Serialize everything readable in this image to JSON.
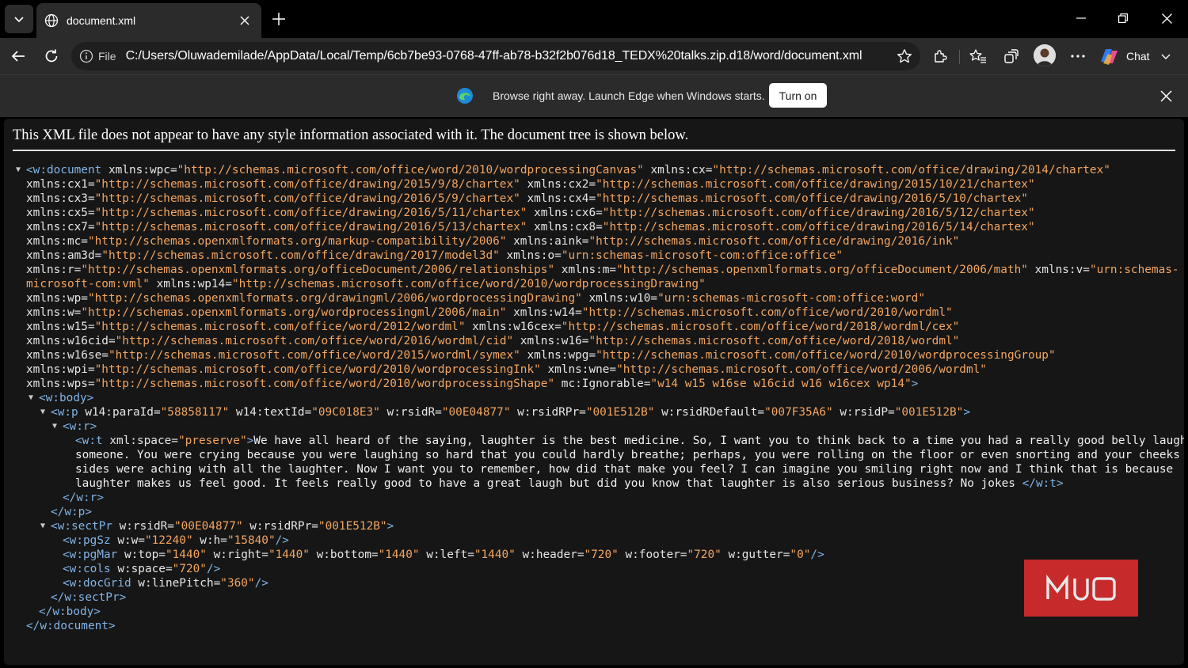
{
  "tab": {
    "title": "document.xml"
  },
  "address": {
    "scheme_label": "File",
    "url": "C:/Users/Oluwademilade/AppData/Local/Temp/6cb7be93-0768-47ff-ab78-b32f2b076d18_TEDX%20talks.zip.d18/word/document.xml"
  },
  "toolbar": {
    "chat_label": "Chat"
  },
  "banner": {
    "message": "Browse right away. Launch Edge when Windows starts.",
    "button_label": "Turn on"
  },
  "page": {
    "header": "This XML file does not appear to have any style information associated with it. The document tree is shown below."
  },
  "xml_lines": [
    {
      "indent": 28,
      "arrow": "open",
      "parts": [
        [
          "tag",
          "<w:document"
        ],
        [
          "an",
          " xmlns:wpc="
        ],
        [
          "av",
          "\"http://schemas.microsoft.com/office/word/2010/wordprocessingCanvas\""
        ],
        [
          "an",
          " xmlns:cx="
        ],
        [
          "av",
          "\"http://schemas.microsoft.com/office/drawing/2014/chartex\""
        ]
      ]
    },
    {
      "indent": 28,
      "parts": [
        [
          "an",
          "xmlns:cx1="
        ],
        [
          "av",
          "\"http://schemas.microsoft.com/office/drawing/2015/9/8/chartex\""
        ],
        [
          "an",
          " xmlns:cx2="
        ],
        [
          "av",
          "\"http://schemas.microsoft.com/office/drawing/2015/10/21/chartex\""
        ]
      ]
    },
    {
      "indent": 28,
      "parts": [
        [
          "an",
          "xmlns:cx3="
        ],
        [
          "av",
          "\"http://schemas.microsoft.com/office/drawing/2016/5/9/chartex\""
        ],
        [
          "an",
          " xmlns:cx4="
        ],
        [
          "av",
          "\"http://schemas.microsoft.com/office/drawing/2016/5/10/chartex\""
        ]
      ]
    },
    {
      "indent": 28,
      "parts": [
        [
          "an",
          "xmlns:cx5="
        ],
        [
          "av",
          "\"http://schemas.microsoft.com/office/drawing/2016/5/11/chartex\""
        ],
        [
          "an",
          " xmlns:cx6="
        ],
        [
          "av",
          "\"http://schemas.microsoft.com/office/drawing/2016/5/12/chartex\""
        ]
      ]
    },
    {
      "indent": 28,
      "parts": [
        [
          "an",
          "xmlns:cx7="
        ],
        [
          "av",
          "\"http://schemas.microsoft.com/office/drawing/2016/5/13/chartex\""
        ],
        [
          "an",
          " xmlns:cx8="
        ],
        [
          "av",
          "\"http://schemas.microsoft.com/office/drawing/2016/5/14/chartex\""
        ]
      ]
    },
    {
      "indent": 28,
      "parts": [
        [
          "an",
          "xmlns:mc="
        ],
        [
          "av",
          "\"http://schemas.openxmlformats.org/markup-compatibility/2006\""
        ],
        [
          "an",
          " xmlns:aink="
        ],
        [
          "av",
          "\"http://schemas.microsoft.com/office/drawing/2016/ink\""
        ]
      ]
    },
    {
      "indent": 28,
      "parts": [
        [
          "an",
          "xmlns:am3d="
        ],
        [
          "av",
          "\"http://schemas.microsoft.com/office/drawing/2017/model3d\""
        ],
        [
          "an",
          " xmlns:o="
        ],
        [
          "av",
          "\"urn:schemas-microsoft-com:office:office\""
        ]
      ]
    },
    {
      "indent": 28,
      "parts": [
        [
          "an",
          "xmlns:r="
        ],
        [
          "av",
          "\"http://schemas.openxmlformats.org/officeDocument/2006/relationships\""
        ],
        [
          "an",
          " xmlns:m="
        ],
        [
          "av",
          "\"http://schemas.openxmlformats.org/officeDocument/2006/math\""
        ],
        [
          "an",
          " xmlns:v="
        ],
        [
          "av",
          "\"urn:schemas-"
        ]
      ]
    },
    {
      "indent": 28,
      "parts": [
        [
          "av",
          "microsoft-com:vml\""
        ],
        [
          "an",
          " xmlns:wp14="
        ],
        [
          "av",
          "\"http://schemas.microsoft.com/office/word/2010/wordprocessingDrawing\""
        ]
      ]
    },
    {
      "indent": 28,
      "parts": [
        [
          "an",
          "xmlns:wp="
        ],
        [
          "av",
          "\"http://schemas.openxmlformats.org/drawingml/2006/wordprocessingDrawing\""
        ],
        [
          "an",
          " xmlns:w10="
        ],
        [
          "av",
          "\"urn:schemas-microsoft-com:office:word\""
        ]
      ]
    },
    {
      "indent": 28,
      "parts": [
        [
          "an",
          "xmlns:w="
        ],
        [
          "av",
          "\"http://schemas.openxmlformats.org/wordprocessingml/2006/main\""
        ],
        [
          "an",
          " xmlns:w14="
        ],
        [
          "av",
          "\"http://schemas.microsoft.com/office/word/2010/wordml\""
        ]
      ]
    },
    {
      "indent": 28,
      "parts": [
        [
          "an",
          "xmlns:w15="
        ],
        [
          "av",
          "\"http://schemas.microsoft.com/office/word/2012/wordml\""
        ],
        [
          "an",
          " xmlns:w16cex="
        ],
        [
          "av",
          "\"http://schemas.microsoft.com/office/word/2018/wordml/cex\""
        ]
      ]
    },
    {
      "indent": 28,
      "parts": [
        [
          "an",
          "xmlns:w16cid="
        ],
        [
          "av",
          "\"http://schemas.microsoft.com/office/word/2016/wordml/cid\""
        ],
        [
          "an",
          " xmlns:w16="
        ],
        [
          "av",
          "\"http://schemas.microsoft.com/office/word/2018/wordml\""
        ]
      ]
    },
    {
      "indent": 28,
      "parts": [
        [
          "an",
          "xmlns:w16se="
        ],
        [
          "av",
          "\"http://schemas.microsoft.com/office/word/2015/wordml/symex\""
        ],
        [
          "an",
          " xmlns:wpg="
        ],
        [
          "av",
          "\"http://schemas.microsoft.com/office/word/2010/wordprocessingGroup\""
        ]
      ]
    },
    {
      "indent": 28,
      "parts": [
        [
          "an",
          "xmlns:wpi="
        ],
        [
          "av",
          "\"http://schemas.microsoft.com/office/word/2010/wordprocessingInk\""
        ],
        [
          "an",
          " xmlns:wne="
        ],
        [
          "av",
          "\"http://schemas.microsoft.com/office/word/2006/wordml\""
        ]
      ]
    },
    {
      "indent": 28,
      "parts": [
        [
          "an",
          "xmlns:wps="
        ],
        [
          "av",
          "\"http://schemas.microsoft.com/office/word/2010/wordprocessingShape\""
        ],
        [
          "an",
          " mc:Ignorable="
        ],
        [
          "av",
          "\"w14 w15 w16se w16cid w16 w16cex wp14\""
        ],
        [
          "tag",
          ">"
        ]
      ]
    },
    {
      "indent": 44,
      "arrow": "open",
      "parts": [
        [
          "tag",
          "<w:body>"
        ]
      ]
    },
    {
      "indent": 59,
      "arrow": "open",
      "parts": [
        [
          "tag",
          "<w:p"
        ],
        [
          "an",
          " w14:paraId="
        ],
        [
          "av",
          "\"58858117\""
        ],
        [
          "an",
          " w14:textId="
        ],
        [
          "av",
          "\"09C018E3\""
        ],
        [
          "an",
          " w:rsidR="
        ],
        [
          "av",
          "\"00E04877\""
        ],
        [
          "an",
          " w:rsidRPr="
        ],
        [
          "av",
          "\"001E512B\""
        ],
        [
          "an",
          " w:rsidRDefault="
        ],
        [
          "av",
          "\"007F35A6\""
        ],
        [
          "an",
          " w:rsidP="
        ],
        [
          "av",
          "\"001E512B\""
        ],
        [
          "tag",
          ">"
        ]
      ]
    },
    {
      "indent": 74,
      "arrow": "open",
      "parts": [
        [
          "tag",
          "<w:r>"
        ]
      ]
    },
    {
      "indent": 90,
      "parts": [
        [
          "tag",
          "<w:t"
        ],
        [
          "an",
          " xml:space="
        ],
        [
          "av",
          "\"preserve\""
        ],
        [
          "tag",
          ">"
        ],
        [
          "tx",
          "We have all heard of the saying, laughter is the best medicine. So, I want you to think back to a time you had a really good belly laugh with"
        ]
      ]
    },
    {
      "indent": 90,
      "parts": [
        [
          "tx",
          "someone. You were crying because you were laughing so hard that you could hardly breathe; perhaps, you were rolling on the floor or even snorting and your cheeks and"
        ]
      ]
    },
    {
      "indent": 90,
      "parts": [
        [
          "tx",
          "sides were aching with all the laughter. Now I want you to remember, how did that make you feel? I can imagine you smiling right now and I think that is because"
        ]
      ]
    },
    {
      "indent": 90,
      "parts": [
        [
          "tx",
          "laughter makes us feel good. It feels really good to have a great laugh but did you know that laughter is also serious business? No jokes "
        ],
        [
          "tag",
          "</w:t>"
        ]
      ]
    },
    {
      "indent": 74,
      "parts": [
        [
          "tag",
          "</w:r>"
        ]
      ]
    },
    {
      "indent": 59,
      "parts": [
        [
          "tag",
          "</w:p>"
        ]
      ]
    },
    {
      "indent": 59,
      "arrow": "open",
      "parts": [
        [
          "tag",
          "<w:sectPr"
        ],
        [
          "an",
          " w:rsidR="
        ],
        [
          "av",
          "\"00E04877\""
        ],
        [
          "an",
          " w:rsidRPr="
        ],
        [
          "av",
          "\"001E512B\""
        ],
        [
          "tag",
          ">"
        ]
      ]
    },
    {
      "indent": 74,
      "parts": [
        [
          "tag",
          "<w:pgSz"
        ],
        [
          "an",
          " w:w="
        ],
        [
          "av",
          "\"12240\""
        ],
        [
          "an",
          " w:h="
        ],
        [
          "av",
          "\"15840\""
        ],
        [
          "tag",
          "/>"
        ]
      ]
    },
    {
      "indent": 74,
      "parts": [
        [
          "tag",
          "<w:pgMar"
        ],
        [
          "an",
          " w:top="
        ],
        [
          "av",
          "\"1440\""
        ],
        [
          "an",
          " w:right="
        ],
        [
          "av",
          "\"1440\""
        ],
        [
          "an",
          " w:bottom="
        ],
        [
          "av",
          "\"1440\""
        ],
        [
          "an",
          " w:left="
        ],
        [
          "av",
          "\"1440\""
        ],
        [
          "an",
          " w:header="
        ],
        [
          "av",
          "\"720\""
        ],
        [
          "an",
          " w:footer="
        ],
        [
          "av",
          "\"720\""
        ],
        [
          "an",
          " w:gutter="
        ],
        [
          "av",
          "\"0\""
        ],
        [
          "tag",
          "/>"
        ]
      ]
    },
    {
      "indent": 74,
      "parts": [
        [
          "tag",
          "<w:cols"
        ],
        [
          "an",
          " w:space="
        ],
        [
          "av",
          "\"720\""
        ],
        [
          "tag",
          "/>"
        ]
      ]
    },
    {
      "indent": 74,
      "parts": [
        [
          "tag",
          "<w:docGrid"
        ],
        [
          "an",
          " w:linePitch="
        ],
        [
          "av",
          "\"360\""
        ],
        [
          "tag",
          "/>"
        ]
      ]
    },
    {
      "indent": 59,
      "parts": [
        [
          "tag",
          "</w:sectPr>"
        ]
      ]
    },
    {
      "indent": 44,
      "parts": [
        [
          "tag",
          "</w:body>"
        ]
      ]
    },
    {
      "indent": 28,
      "parts": [
        [
          "tag",
          "</w:document>"
        ]
      ]
    }
  ],
  "watermark": {
    "text": "MUO",
    "color": "#c62a2a"
  },
  "colors": {
    "tag": "#80b4e6",
    "attr_value": "#f2a561",
    "background": "#161616"
  },
  "icons": [
    "tab-list-icon",
    "globe-icon",
    "close-icon",
    "plus-icon",
    "minimize-icon",
    "restore-icon",
    "back-icon",
    "refresh-icon",
    "info-icon",
    "favorite-star-icon",
    "extensions-icon",
    "favorites-icon",
    "collections-icon",
    "more-icon",
    "copilot-icon",
    "chevron-down-icon",
    "edge-logo-icon"
  ]
}
